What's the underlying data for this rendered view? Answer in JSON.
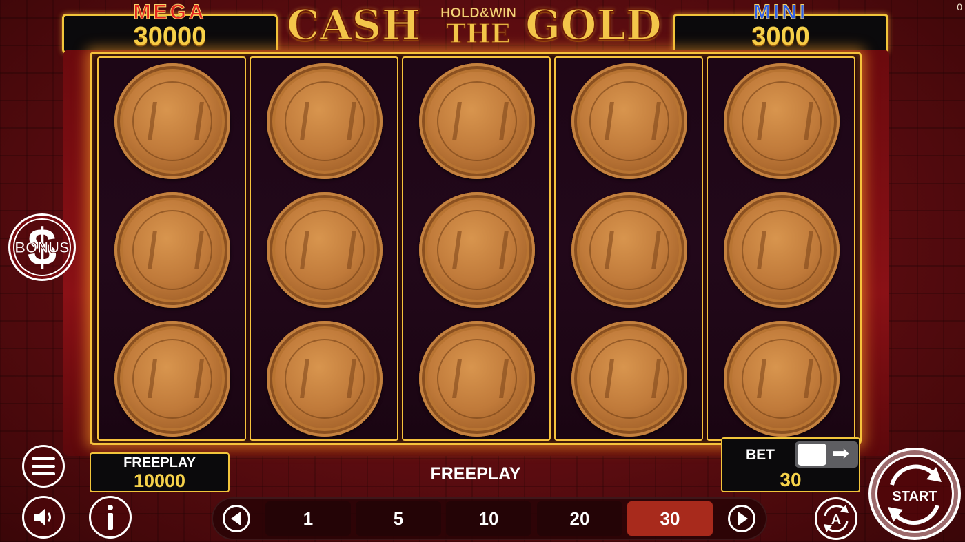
{
  "corner_counter": "0",
  "jackpots": {
    "mega": {
      "label": "MEGA",
      "value": "30000"
    },
    "mini": {
      "label": "MINI",
      "value": "3000"
    }
  },
  "logo": {
    "word1": "CASH",
    "word2_top": "HOLD&WIN",
    "word2_bottom": "THE",
    "word3": "GOLD"
  },
  "reels": {
    "columns": 5,
    "rows": 3,
    "symbol": "coin-symbol"
  },
  "bonus": {
    "label": "BONUS",
    "glyph": "$"
  },
  "credit": {
    "label": "FREEPLAY",
    "value": "10000"
  },
  "status_text": "FREEPLAY",
  "bet": {
    "label": "BET",
    "value": "30",
    "toggle_arrow": "➡"
  },
  "bet_options": [
    "1",
    "5",
    "10",
    "20",
    "30"
  ],
  "selected_bet": "30",
  "start": {
    "label": "START"
  },
  "icons": {
    "menu": "menu-icon",
    "sound": "speaker-icon",
    "info": "info-icon",
    "autoplay": "autoplay-icon",
    "prev": "chevron-left-icon",
    "next": "chevron-right-icon"
  },
  "colors": {
    "gold": "#f6c23c",
    "jackpot_value": "#f6d24a",
    "mega": "#e4251f",
    "mini": "#2f5fe6",
    "selected_bet": "#a82a1c"
  }
}
